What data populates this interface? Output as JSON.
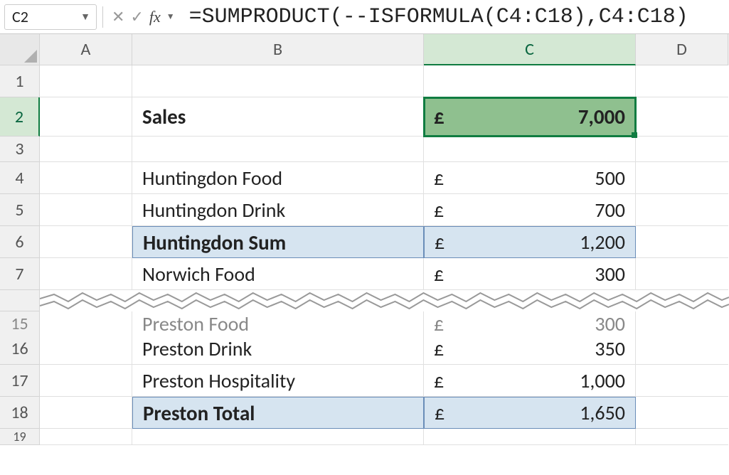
{
  "nameBox": "C2",
  "formula": "=SUMPRODUCT(--ISFORMULA(C4:C18),C4:C18)",
  "columns": [
    "A",
    "B",
    "C",
    "D"
  ],
  "chart_data": {
    "type": "table",
    "title": "Sales",
    "currency": "£",
    "total": "7,000",
    "rows": [
      {
        "r": 4,
        "label": "Huntingdon Food",
        "value": "500",
        "bold": false,
        "highlight": false
      },
      {
        "r": 5,
        "label": "Huntingdon Drink",
        "value": "700",
        "bold": false,
        "highlight": false
      },
      {
        "r": 6,
        "label": "Huntingdon Sum",
        "value": "1,200",
        "bold": true,
        "highlight": true
      },
      {
        "r": 7,
        "label": "Norwich Food",
        "value": "300",
        "bold": false,
        "highlight": false
      },
      {
        "r": 15,
        "label": "Preston Food",
        "value": "300",
        "bold": false,
        "highlight": false,
        "partial": true
      },
      {
        "r": 16,
        "label": "Preston Drink",
        "value": "350",
        "bold": false,
        "highlight": false
      },
      {
        "r": 17,
        "label": "Preston Hospitality",
        "value": "1,000",
        "bold": false,
        "highlight": false
      },
      {
        "r": 18,
        "label": "Preston Total",
        "value": "1,650",
        "bold": true,
        "highlight": true
      }
    ]
  },
  "rowNums": {
    "r1": "1",
    "r2": "2",
    "r3": "3",
    "r4": "4",
    "r5": "5",
    "r6": "6",
    "r7": "7",
    "r15": "15",
    "r16": "16",
    "r17": "17",
    "r18": "18",
    "r19": "19"
  }
}
